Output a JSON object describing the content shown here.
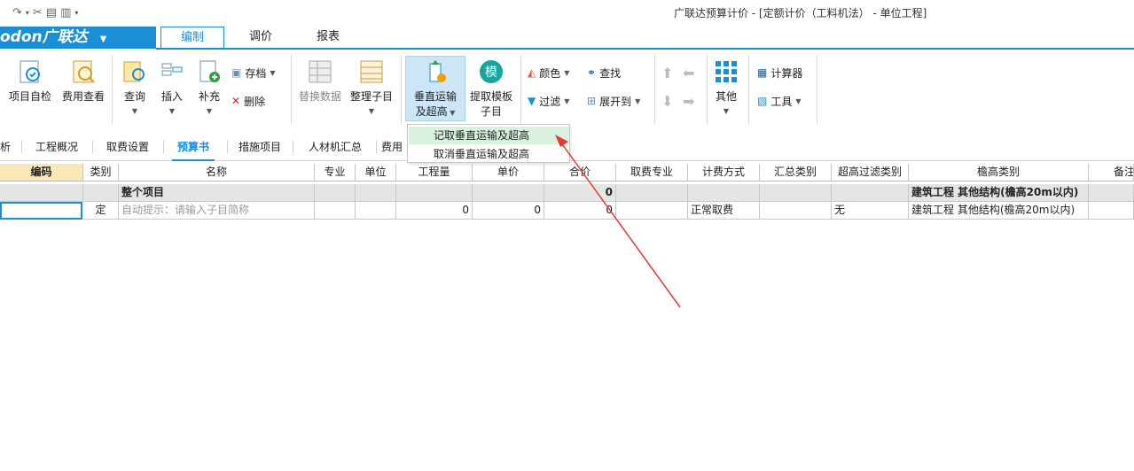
{
  "quick_access": {
    "icons": [
      "redo-icon",
      "cut-icon",
      "copy-icon",
      "paste-icon",
      "customize-icon"
    ]
  },
  "app_title": "广联达预算计价 - [定额计价（工料机法） - 单位工程]",
  "ribbon_tabs": {
    "logo": "odon广联达",
    "logo_caret": "▼",
    "tabs": [
      "编制",
      "调价",
      "报表"
    ]
  },
  "ribbon": {
    "project_check": "项目自检",
    "fee_view": "费用查看",
    "query": "查询",
    "insert": "插入",
    "supplement": "补充",
    "archive": "存档",
    "delete": "删除",
    "replace_data": "替换数据",
    "organize_sub": "整理子目",
    "vertical_transport_1": "垂直运输",
    "vertical_transport_2": "及超高",
    "extract_template_1": "提取模板",
    "extract_template_2": "子目",
    "template_glyph": "模",
    "color": "颜色",
    "find": "查找",
    "filter": "过滤",
    "expand_to": "展开到",
    "other": "其他",
    "calculator": "计算器",
    "tools": "工具"
  },
  "menu": {
    "items": [
      "记取垂直运输及超高",
      "取消垂直运输及超高"
    ]
  },
  "page_tabs": [
    "析",
    "工程概况",
    "取费设置",
    "预算书",
    "措施项目",
    "人材机汇总",
    "费用"
  ],
  "grid": {
    "headers": [
      "编码",
      "类别",
      "名称",
      "专业",
      "单位",
      "工程量",
      "单价",
      "合价",
      "取费专业",
      "计费方式",
      "汇总类别",
      "超高过滤类别",
      "檐高类别",
      "备注"
    ],
    "group_row": {
      "name": "整个项目",
      "total": "0",
      "eave": "建筑工程  其他结构(檐高20m以内)"
    },
    "data_row": {
      "code": "",
      "type": "定",
      "name": "自动提示：请输入子目简称",
      "quantity": "0",
      "unit_price": "0",
      "total": "0",
      "fee_method": "正常取费",
      "over_height_filter": "无",
      "eave": "建筑工程  其他结构(檐高20m以内)"
    }
  },
  "colors": {
    "accent": "#1a8fd6",
    "annotation_arrow": "#e53935",
    "menu_hover": "#d9f2df"
  }
}
